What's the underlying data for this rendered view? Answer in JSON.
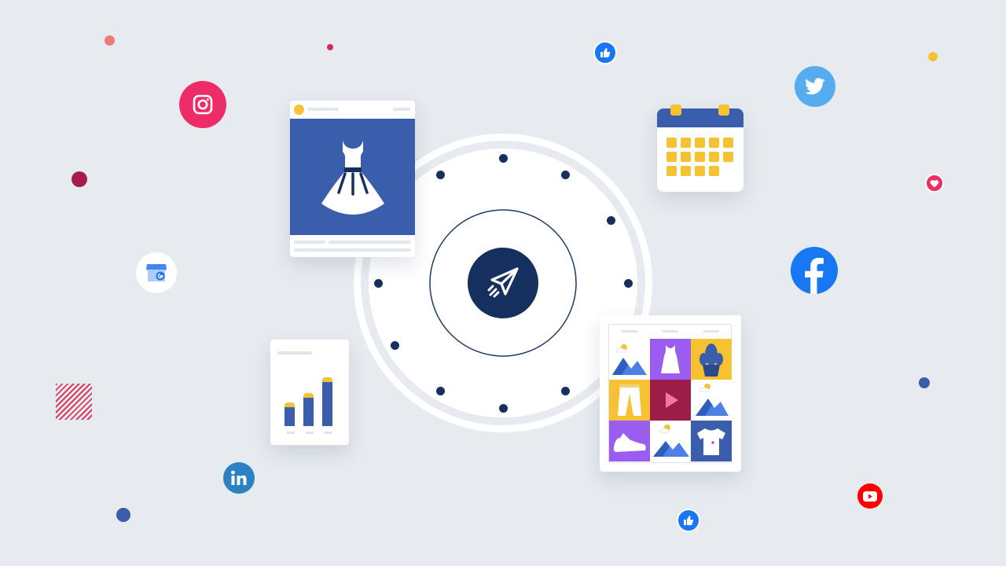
{
  "scene": {
    "title": "",
    "colors": {
      "background": "#e7ebf0",
      "navy": "#15305f",
      "brand_blue": "#3a5eab",
      "accent_yellow": "#f6c232",
      "purple": "#9b5cf0",
      "crimson": "#9e1c4a"
    }
  },
  "center_hub": {
    "icon": "paper-plane-icon",
    "orbit_dot_count": 12
  },
  "social_icons": [
    {
      "name": "instagram-icon",
      "color": "#ee2c67"
    },
    {
      "name": "twitter-icon",
      "color": "#55acee"
    },
    {
      "name": "facebook-icon",
      "color": "#1877f2"
    },
    {
      "name": "linkedin-icon",
      "color": "#2a82c5"
    },
    {
      "name": "youtube-icon",
      "color": "#ff0000"
    },
    {
      "name": "google-my-business-icon",
      "color": "#4285f4"
    },
    {
      "name": "thumbs-up-icon",
      "color": "#1877f2"
    },
    {
      "name": "heart-icon",
      "color": "#ef2d63"
    }
  ],
  "cards": {
    "post": {
      "image_icon": "dress-icon"
    },
    "calendar": {
      "icon": "calendar-icon"
    },
    "bar_chart": {
      "bars": [
        0.38,
        0.52,
        0.77
      ]
    },
    "media_grid": {
      "tiles": [
        "landscape-icon",
        "dress-icon",
        "plant-icon",
        "pants-icon",
        "play-icon",
        "landscape-icon",
        "sneaker-icon",
        "landscape-icon",
        "tshirt-icon"
      ]
    }
  }
}
